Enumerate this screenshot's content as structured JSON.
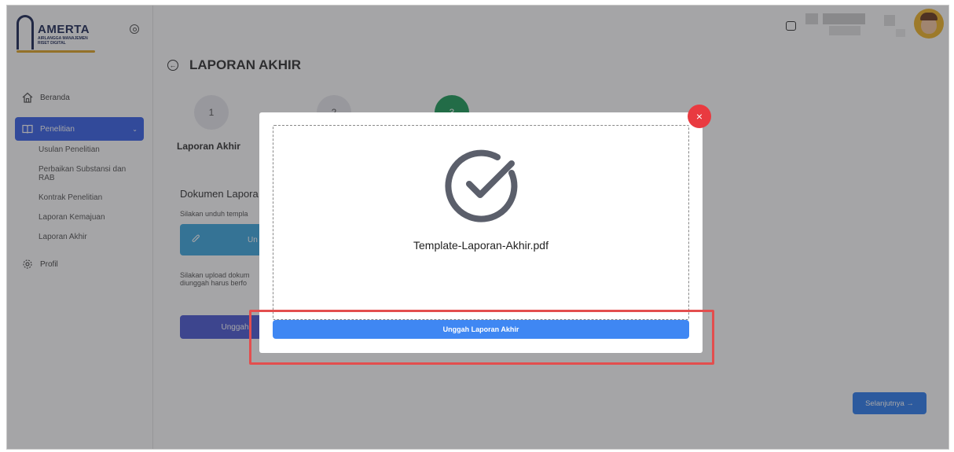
{
  "logo": {
    "title": "AMERTA",
    "subtitle_1": "AIRLANGGA MANAJEMEN",
    "subtitle_2": "RISET DIGITAL"
  },
  "sidebar": {
    "items": [
      {
        "label": "Beranda",
        "icon": "home-icon"
      },
      {
        "label": "Penelitian",
        "icon": "book-icon",
        "active": true
      },
      {
        "label": "Profil",
        "icon": "gear-icon"
      }
    ],
    "sub_items": [
      "Usulan Penelitian",
      "Perbaikan Substansi dan RAB",
      "Kontrak Penelitian",
      "Laporan Kemajuan",
      "Laporan Akhir"
    ]
  },
  "page": {
    "title": "LAPORAN AKHIR",
    "steps": [
      "1",
      "2",
      "3"
    ],
    "step_label": "Laporan Akhir",
    "document_title": "Dokumen Lapora",
    "document_sub": "Silakan unduh templa",
    "upload_label": "Un",
    "note_line1": "Silakan upload dokum",
    "note_line2": "diunggah harus berfo",
    "unggah_label": "Unggah",
    "next_label": "Selanjutnya →"
  },
  "modal": {
    "file_name": "Template-Laporan-Akhir.pdf",
    "button_label": "Unggah Laporan Akhir",
    "close_symbol": "×"
  },
  "colors": {
    "primary": "#3f87f3",
    "sidebar_active": "#3a62e8",
    "close": "#e93a40",
    "highlight": "#e34e4e",
    "step_done": "#1e9e5a"
  }
}
